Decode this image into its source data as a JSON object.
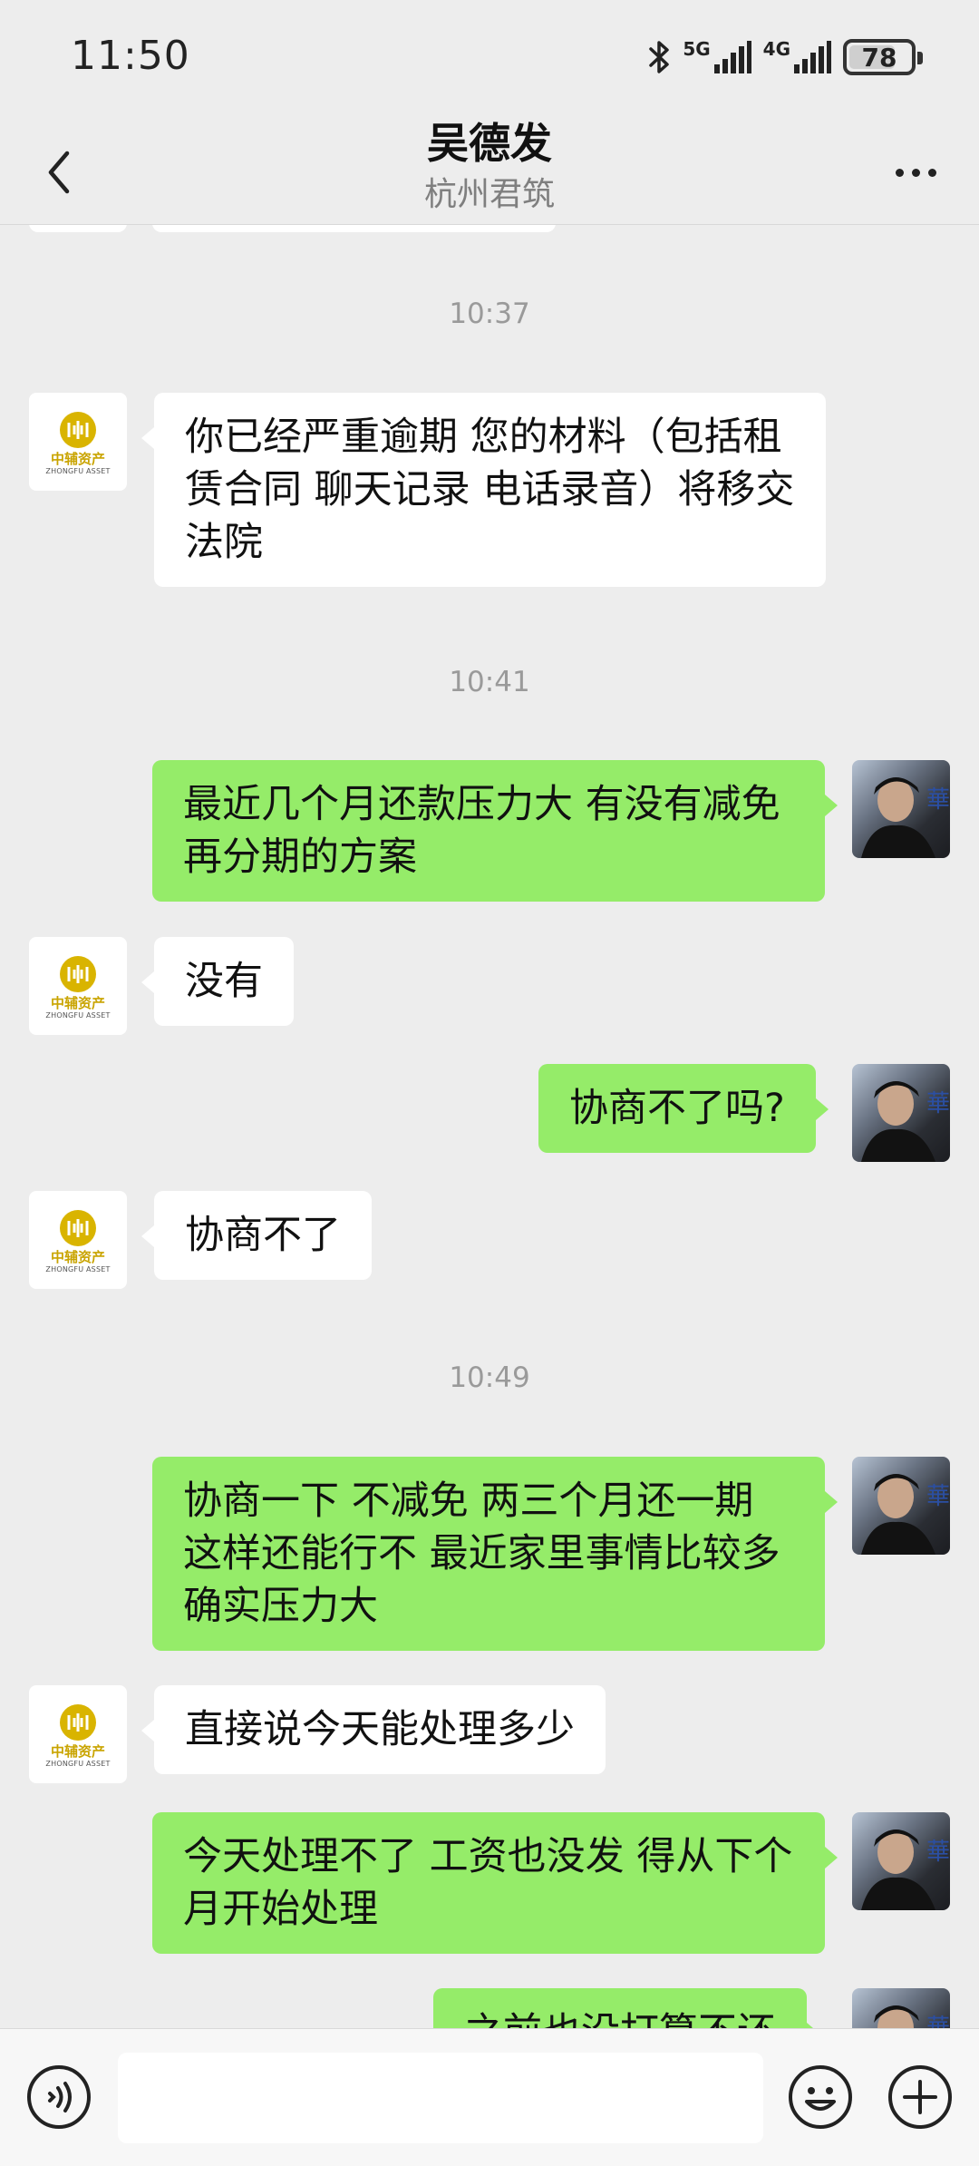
{
  "status_bar": {
    "time": "11:50",
    "network_1": "5G",
    "network_2": "4G",
    "battery": "78",
    "battery_level_percent": 78
  },
  "header": {
    "title": "吴德发",
    "subtitle": "杭州君筑"
  },
  "contact_avatar": {
    "logo_cn": "中辅资产",
    "logo_en": "ZHONGFU ASSET"
  },
  "messages": [
    {
      "type": "timestamp",
      "text": "10:37"
    },
    {
      "type": "incoming",
      "text": "你已经严重逾期  您的材料（包括租赁合同 聊天记录 电话录音）将移交法院"
    },
    {
      "type": "timestamp",
      "text": "10:41"
    },
    {
      "type": "outgoing",
      "text": "最近几个月还款压力大  有没有减免再分期的方案"
    },
    {
      "type": "incoming",
      "text": "没有"
    },
    {
      "type": "outgoing",
      "text": "协商不了吗?"
    },
    {
      "type": "incoming",
      "text": "协商不了"
    },
    {
      "type": "timestamp",
      "text": "10:49"
    },
    {
      "type": "outgoing",
      "text": "协商一下 不减免 两三个月还一期 这样还能行不  最近家里事情比较多 确实压力大"
    },
    {
      "type": "incoming",
      "text": "直接说今天能处理多少"
    },
    {
      "type": "outgoing",
      "text": "今天处理不了 工资也没发 得从下个月开始处理"
    },
    {
      "type": "outgoing",
      "text": "之前也没打算不还"
    }
  ],
  "input": {
    "placeholder": ""
  },
  "icons": {
    "back": "chevron-left-icon",
    "more": "more-dots-icon",
    "voice": "voice-icon",
    "emoji": "emoji-icon",
    "plus": "plus-icon",
    "bluetooth": "bluetooth-icon"
  },
  "colors": {
    "background": "#ededed",
    "outgoing_bubble": "#95ec69",
    "incoming_bubble": "#ffffff",
    "timestamp_text": "#9a9a9a"
  }
}
